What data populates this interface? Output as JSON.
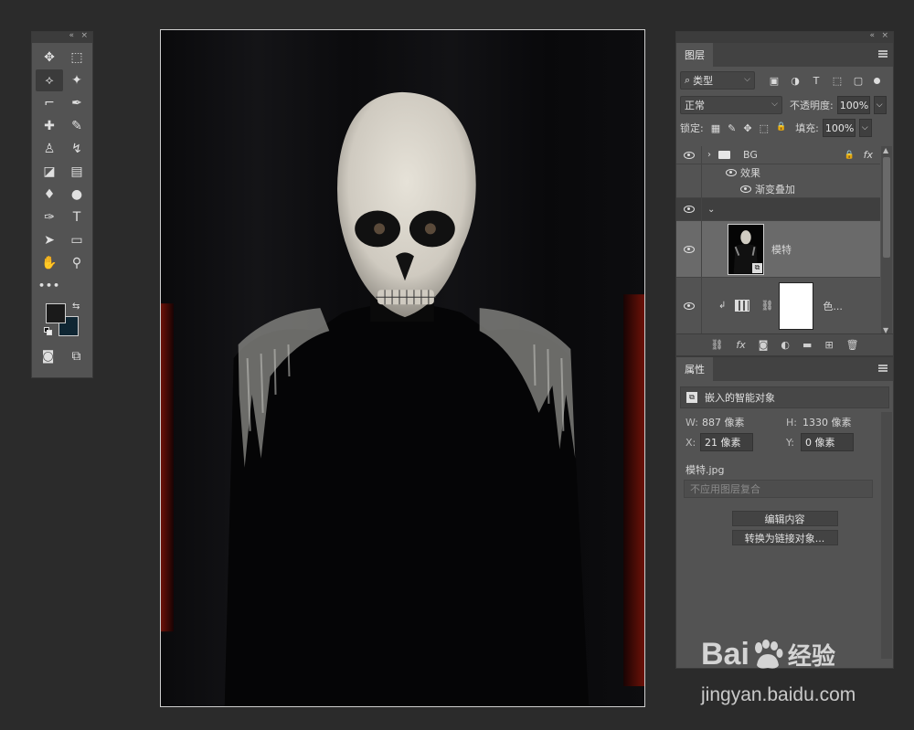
{
  "toolbox": {
    "collapse_glyph": "«",
    "close_glyph": "×",
    "tools": [
      {
        "name": "move-tool",
        "glyph": "✥"
      },
      {
        "name": "marquee-tool",
        "glyph": "⬚"
      },
      {
        "name": "lasso-tool",
        "glyph": "⟡"
      },
      {
        "name": "magic-wand-tool",
        "glyph": "✦"
      },
      {
        "name": "crop-tool",
        "glyph": "⌐"
      },
      {
        "name": "eyedropper-tool",
        "glyph": "✒"
      },
      {
        "name": "healing-brush-tool",
        "glyph": "✚"
      },
      {
        "name": "brush-tool",
        "glyph": "✎"
      },
      {
        "name": "clone-stamp-tool",
        "glyph": "♙"
      },
      {
        "name": "history-brush-tool",
        "glyph": "↯"
      },
      {
        "name": "eraser-tool",
        "glyph": "◪"
      },
      {
        "name": "gradient-tool",
        "glyph": "▤"
      },
      {
        "name": "blur-tool",
        "glyph": "♦"
      },
      {
        "name": "dodge-tool",
        "glyph": "●"
      },
      {
        "name": "pen-tool",
        "glyph": "✑"
      },
      {
        "name": "type-tool",
        "glyph": "T"
      },
      {
        "name": "path-selection-tool",
        "glyph": "➤"
      },
      {
        "name": "rectangle-tool",
        "glyph": "▭"
      },
      {
        "name": "hand-tool",
        "glyph": "✋"
      },
      {
        "name": "zoom-tool",
        "glyph": "⚲"
      }
    ],
    "more_glyph": "•••"
  },
  "layers_panel": {
    "collapse_glyph": "«",
    "close_glyph": "×",
    "tab": "图层",
    "filter_kind": "类型",
    "filter_prefix": "⌕",
    "filter_icons": [
      "▣",
      "◑",
      "T",
      "⬚",
      "▢"
    ],
    "blend_mode": "正常",
    "opacity_label": "不透明度:",
    "opacity_value": "100%",
    "lock_label": "锁定:",
    "lock_icons": [
      "▦",
      "✎",
      "✥",
      "⬚",
      "🔒"
    ],
    "fill_label": "填充:",
    "fill_value": "100%",
    "layers": {
      "bg_group": {
        "name": "BG",
        "lock": "🔒",
        "fx": "fx"
      },
      "effects_label": "效果",
      "effect_item": "渐变叠加",
      "model_layer": {
        "name": "模特"
      },
      "adjust_layer": {
        "name": "色..."
      }
    },
    "bottom_icons": [
      "⛓",
      "fx",
      "◙",
      "◐",
      "▬",
      "⊞",
      "🗑"
    ]
  },
  "properties_panel": {
    "tab": "属性",
    "title": "嵌入的智能对象",
    "w_label": "W:",
    "w_value": "887 像素",
    "h_label": "H:",
    "h_value": "1330 像素",
    "x_label": "X:",
    "x_value": "21 像素",
    "y_label": "Y:",
    "y_value": "0 像素",
    "filename": "模特.jpg",
    "comp_placeholder": "不应用图层复合",
    "edit_button": "编辑内容",
    "convert_button": "转换为链接对象..."
  },
  "watermark": {
    "brand_left": "Bai",
    "brand_right": "经验",
    "url": "jingyan.baidu.com"
  },
  "colors": {
    "panel": "#535353",
    "foreground": "#1a1a1a",
    "background": "#0f2633",
    "selected_row": "#6a6a6a"
  }
}
